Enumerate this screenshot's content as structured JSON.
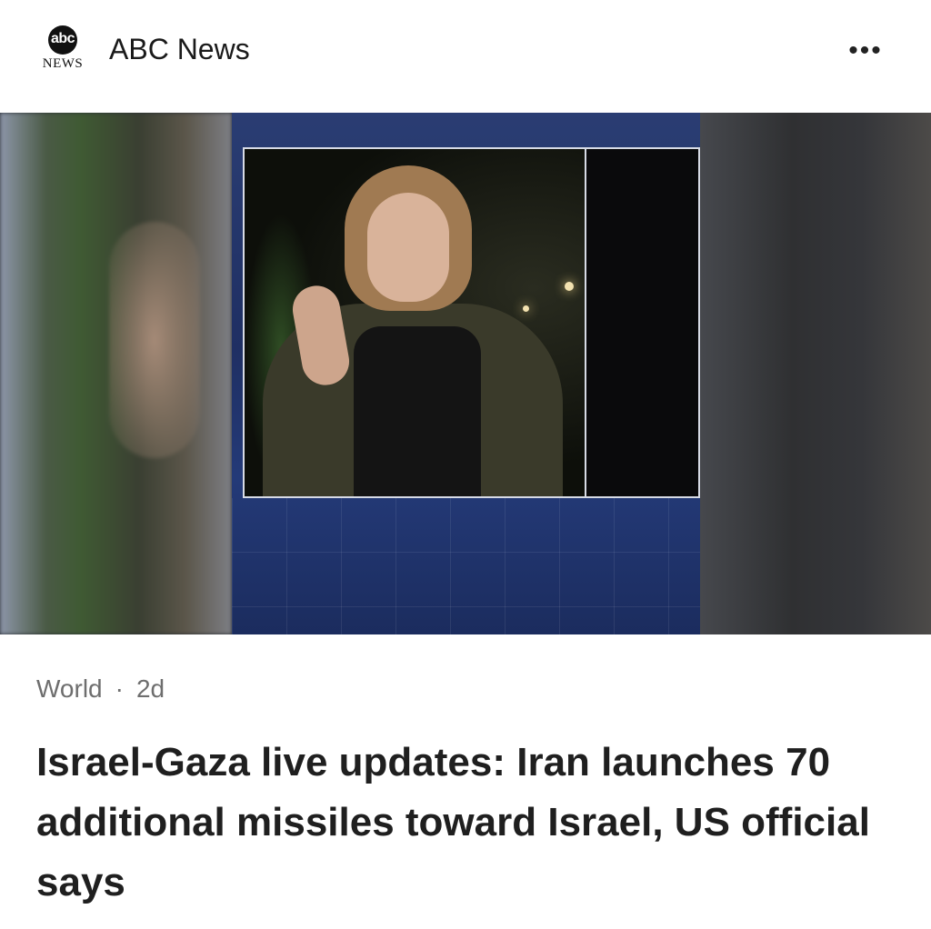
{
  "header": {
    "logo_top": "abc",
    "logo_bottom": "NEWS",
    "source_name": "ABC News",
    "more_icon": "more-horizontal-icon",
    "more_label": "•••"
  },
  "hero": {
    "alt": "Correspondent reporting on camera at night, shown in a news broadcast split-screen"
  },
  "article": {
    "category": "World",
    "separator": "·",
    "age": "2d",
    "headline": "Israel-Gaza live updates: Iran launches 70 additional missiles toward Israel, US official says"
  },
  "colors": {
    "background": "#ffffff",
    "headline": "#1f1f1f",
    "meta": "#6e6e6e",
    "broadcast_blue": "#22356b"
  }
}
